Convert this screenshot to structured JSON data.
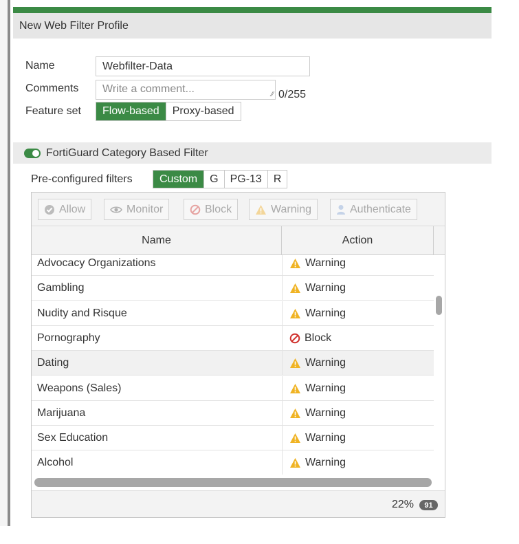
{
  "window": {
    "title": "New Web Filter Profile"
  },
  "form": {
    "name_label": "Name",
    "name_value": "Webfilter-Data",
    "comments_label": "Comments",
    "comments_placeholder": "Write a comment...",
    "char_count": "0/255",
    "feature_set_label": "Feature set",
    "feature_set_options": [
      "Flow-based",
      "Proxy-based"
    ],
    "feature_set_selected": "Flow-based"
  },
  "section": {
    "title": "FortiGuard Category Based Filter",
    "toggle_on": true
  },
  "preconfigured": {
    "label": "Pre-configured filters",
    "options": [
      "Custom",
      "G",
      "PG-13",
      "R"
    ],
    "selected": "Custom"
  },
  "toolbar": {
    "allow": "Allow",
    "monitor": "Monitor",
    "block": "Block",
    "warning": "Warning",
    "authenticate": "Authenticate"
  },
  "table": {
    "columns": [
      "Name",
      "Action"
    ],
    "rows": [
      {
        "name": "Advocacy Organizations",
        "action": "Warning",
        "icon": "warning-icon"
      },
      {
        "name": "Gambling",
        "action": "Warning",
        "icon": "warning-icon"
      },
      {
        "name": "Nudity and Risque",
        "action": "Warning",
        "icon": "warning-icon"
      },
      {
        "name": "Pornography",
        "action": "Block",
        "icon": "block-icon"
      },
      {
        "name": "Dating",
        "action": "Warning",
        "icon": "warning-icon",
        "highlighted": true
      },
      {
        "name": "Weapons (Sales)",
        "action": "Warning",
        "icon": "warning-icon"
      },
      {
        "name": "Marijuana",
        "action": "Warning",
        "icon": "warning-icon"
      },
      {
        "name": "Sex Education",
        "action": "Warning",
        "icon": "warning-icon"
      },
      {
        "name": "Alcohol",
        "action": "Warning",
        "icon": "warning-icon"
      }
    ]
  },
  "footer": {
    "percent": "22%",
    "count": "91"
  },
  "colors": {
    "accent": "#3b8a45",
    "warning": "#f0b323",
    "block": "#d0312d"
  }
}
